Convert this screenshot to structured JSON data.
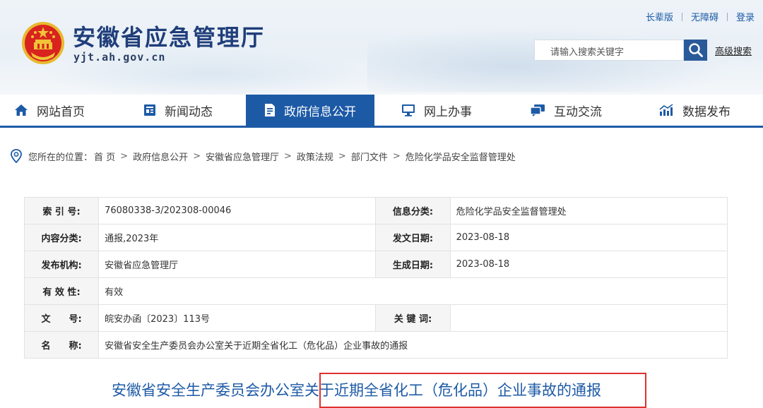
{
  "header": {
    "site_title": "安徽省应急管理厅",
    "domain": "yjt.ah.gov.cn",
    "top_links": [
      "长辈版",
      "无障碍",
      "登录"
    ],
    "search_placeholder": "请输入搜索关键字",
    "advanced_search": "高级搜索"
  },
  "nav": {
    "items": [
      {
        "label": "网站首页",
        "icon": "home-icon"
      },
      {
        "label": "新闻动态",
        "icon": "news-icon"
      },
      {
        "label": "政府信息公开",
        "icon": "document-icon"
      },
      {
        "label": "网上办事",
        "icon": "monitor-icon"
      },
      {
        "label": "互动交流",
        "icon": "chat-icon"
      },
      {
        "label": "数据发布",
        "icon": "chart-icon"
      }
    ],
    "active_index": 2
  },
  "breadcrumb": {
    "prefix": "您所在的位置：",
    "items": [
      "首 页",
      "政府信息公开",
      "安徽省应急管理厅",
      "政策法规",
      "部门文件",
      "危险化学品安全监督管理处"
    ],
    "separator": ">"
  },
  "info": {
    "index_label": "索 引 号:",
    "index_value": "76080338-3/202308-00046",
    "category_label": "信息分类:",
    "category_value": "危险化学品安全监督管理处",
    "content_label": "内容分类:",
    "content_value": "通报,2023年",
    "issue_date_label": "发文日期:",
    "issue_date_value": "2023-08-18",
    "publisher_label": "发布机构:",
    "publisher_value": "安徽省应急管理厅",
    "effective_date_label": "生成日期:",
    "effective_date_value": "2023-08-18",
    "validity_label": "有 效 性:",
    "validity_value": "有效",
    "doc_no_label": "文　　号:",
    "doc_no_value": "皖安办函〔2023〕113号",
    "keywords_label": "关 键 词:",
    "keywords_value": "",
    "name_label": "名　　称:",
    "name_value": "安徽省安全生产委员会办公室关于近期全省化工（危化品）企业事故的通报"
  },
  "document": {
    "title": "安徽省安全生产委员会办公室关于近期全省化工（危化品）企业事故的通报"
  },
  "colors": {
    "brand_blue": "#1d5aa6",
    "title_navy": "#1f3e7a",
    "highlight_red": "#e03030"
  }
}
